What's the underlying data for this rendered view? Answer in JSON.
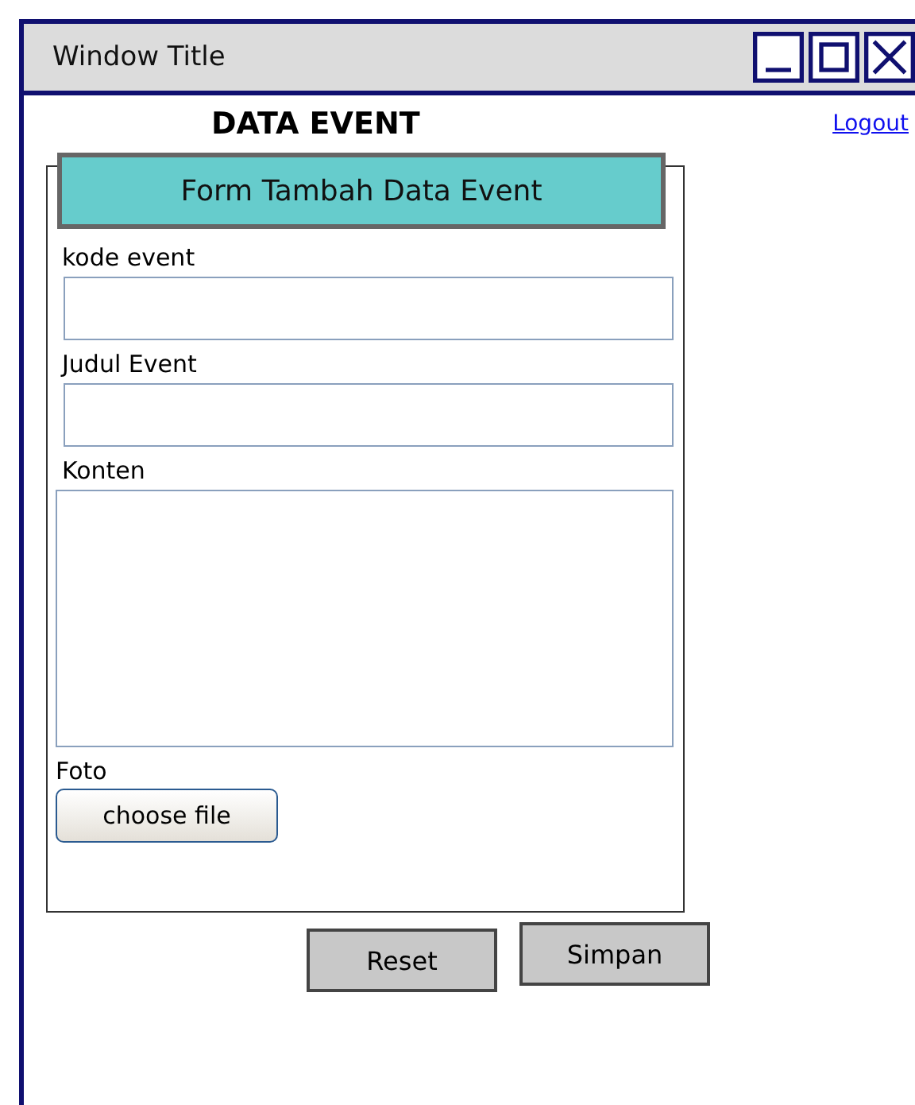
{
  "window": {
    "title": "Window Title"
  },
  "heading": "DATA EVENT",
  "logout_link": "Logout",
  "form": {
    "title": "Form Tambah Data Event",
    "fields": [
      {
        "label": "kode event",
        "kind": "input"
      },
      {
        "label": "Judul Event",
        "kind": "input"
      },
      {
        "label": "Konten",
        "kind": "textarea"
      }
    ],
    "file": {
      "label": "Foto",
      "button": "choose file"
    }
  },
  "buttons": [
    "Reset",
    "Simpan"
  ]
}
